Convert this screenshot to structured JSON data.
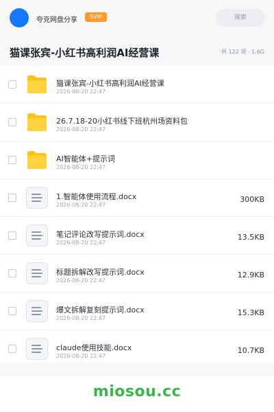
{
  "header": {
    "username": "夸克网盘分享",
    "badge": "SVIP",
    "search_placeholder": "搜索",
    "accent": "#1677ff"
  },
  "folder_title": "猫课张宾-小红书高利润AI经营课",
  "summary": "共 122 项 · 1.6G",
  "files": [
    {
      "type": "folder",
      "icon": "folder-icon",
      "name": "猫课张宾-小红书高利润AI经营课",
      "date": "2026-08-20 22:47",
      "size": ""
    },
    {
      "type": "folder",
      "icon": "folder-icon",
      "name": "26.7.18-20小红书线下班杭州场资料包",
      "date": "2026-08-20 22:47",
      "size": ""
    },
    {
      "type": "folder",
      "icon": "folder-icon",
      "name": "AI智能体+提示词",
      "date": "2026-08-20 22:47",
      "size": ""
    },
    {
      "type": "doc",
      "icon": "document-icon",
      "name": "1.智能体使用流程.docx",
      "date": "2026-08-20 22:47",
      "size": "300KB"
    },
    {
      "type": "doc",
      "icon": "document-icon",
      "name": "笔记评论改写提示词.docx",
      "date": "2026-08-20 22:47",
      "size": "13.5KB"
    },
    {
      "type": "doc",
      "icon": "document-icon",
      "name": "标题拆解改写提示词.docx",
      "date": "2026-08-20 22:47",
      "size": "12.9KB"
    },
    {
      "type": "doc",
      "icon": "document-icon",
      "name": "爆文拆解复刻提示词.docx",
      "date": "2026-08-20 22:47",
      "size": "15.3KB"
    },
    {
      "type": "doc",
      "icon": "document-icon",
      "name": "claude使用技能.docx",
      "date": "2026-08-20 22:47",
      "size": "10.7KB"
    }
  ],
  "watermark": "miosou.cc"
}
